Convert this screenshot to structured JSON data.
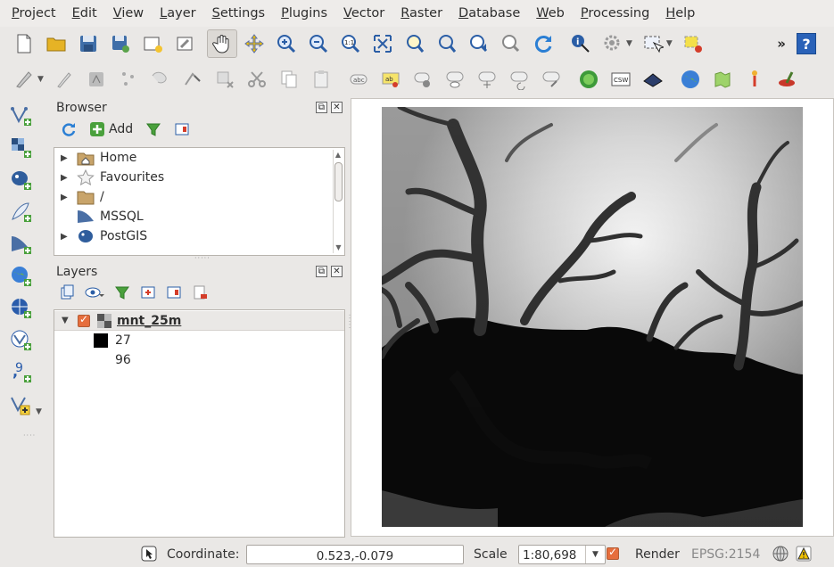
{
  "menu": [
    "Project",
    "Edit",
    "View",
    "Layer",
    "Settings",
    "Plugins",
    "Vector",
    "Raster",
    "Database",
    "Web",
    "Processing",
    "Help"
  ],
  "browser": {
    "title": "Browser",
    "add_label": "Add",
    "items": [
      {
        "label": "Home",
        "icon": "home-folder-icon",
        "expandable": true
      },
      {
        "label": "Favourites",
        "icon": "star-icon",
        "expandable": true
      },
      {
        "label": "/",
        "icon": "folder-icon",
        "expandable": true
      },
      {
        "label": "MSSQL",
        "icon": "mssql-icon",
        "expandable": false
      },
      {
        "label": "PostGIS",
        "icon": "postgis-elephant-icon",
        "expandable": true
      }
    ]
  },
  "layers": {
    "title": "Layers",
    "layer_name": "mnt_25m",
    "legend": [
      {
        "value": "27",
        "color": "#000000"
      },
      {
        "value": "96",
        "color": "#ffffff"
      }
    ]
  },
  "status": {
    "coordinate_label": "Coordinate:",
    "coordinate_value": "0.523,-0.079",
    "scale_label": "Scale",
    "scale_value": "1:80,698",
    "render_label": "Render",
    "crs": "EPSG:2154"
  },
  "colors": {
    "accent_checkbox": "#e66e3d",
    "digitize_green": "#4aa03c"
  }
}
